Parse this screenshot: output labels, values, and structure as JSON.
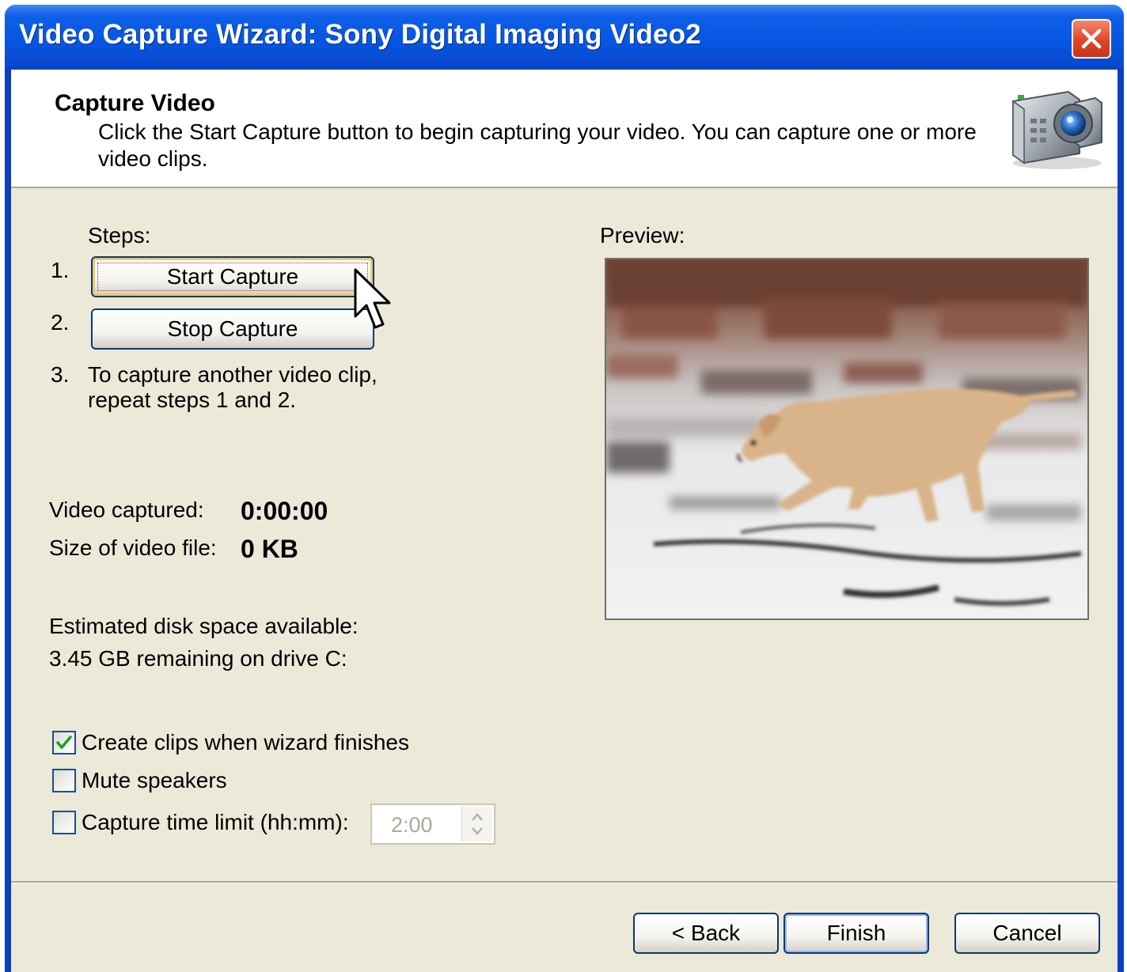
{
  "window": {
    "title": "Video Capture Wizard: Sony Digital Imaging Video2"
  },
  "header": {
    "title": "Capture Video",
    "description": "Click the Start Capture button to begin capturing your video. You can capture one or more video clips.",
    "icon": "camcorder-icon"
  },
  "steps": {
    "label": "Steps:",
    "items": [
      {
        "num": "1.",
        "button": "Start Capture"
      },
      {
        "num": "2.",
        "button": "Stop Capture"
      },
      {
        "num": "3.",
        "text_line1": "To capture another video clip,",
        "text_line2": "repeat steps 1 and 2."
      }
    ]
  },
  "stats": {
    "video_captured_label": "Video captured:",
    "video_captured_value": "0:00:00",
    "file_size_label": "Size of video file:",
    "file_size_value": "0 KB"
  },
  "disk": {
    "label": "Estimated disk space available:",
    "value": "3.45 GB remaining on drive C:"
  },
  "options": [
    {
      "label": "Create clips when wizard finishes",
      "checked": true
    },
    {
      "label": "Mute speakers",
      "checked": false
    },
    {
      "label": "Capture time limit (hh:mm):",
      "checked": false
    }
  ],
  "time_limit": {
    "value": "2:00",
    "enabled": false
  },
  "preview": {
    "label": "Preview:"
  },
  "footer": {
    "back_label": "< Back",
    "finish_label": "Finish",
    "cancel_label": "Cancel"
  },
  "colors": {
    "titlebar": "#0655e0",
    "dialog_bg": "#ece9d8",
    "button_border": "#003c74",
    "checkmark": "#21a121"
  }
}
